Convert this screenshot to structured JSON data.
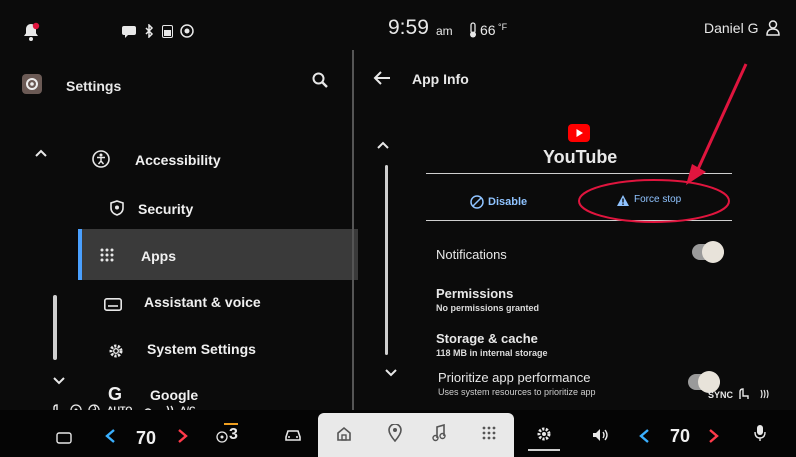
{
  "status": {
    "time": "9:59",
    "ampm": "am",
    "outside_temp": "66",
    "temp_unit": "°F",
    "user": "Daniel G"
  },
  "left": {
    "title": "Settings",
    "items": [
      {
        "label": "Accessibility",
        "icon": "accessibility-icon"
      },
      {
        "label": "Security",
        "icon": "shield-icon"
      },
      {
        "label": "Apps",
        "icon": "apps-grid-icon",
        "selected": true
      },
      {
        "label": "Assistant & voice",
        "icon": "keyboard-icon"
      },
      {
        "label": "System Settings",
        "icon": "gear-icon"
      },
      {
        "label": "Google",
        "icon": "google-icon"
      }
    ]
  },
  "right": {
    "title": "App Info",
    "app_name": "YouTube",
    "disable_label": "Disable",
    "force_stop_label": "Force stop",
    "notifications_label": "Notifications",
    "permissions_label": "Permissions",
    "permissions_sub": "No permissions granted",
    "storage_label": "Storage & cache",
    "storage_sub": "118 MB in internal storage",
    "prioritize_label": "Prioritize app performance",
    "prioritize_sub": "Uses system resources to prioritize app"
  },
  "climate": {
    "left_temp": "70",
    "right_temp": "70",
    "fan_level": "3",
    "auto_label": "AUTO",
    "ac_label": "A/C",
    "sync_label": "SYNC"
  },
  "colors": {
    "accent_blue": "#4aa0ff",
    "annotation_red": "#e0153e",
    "youtube_red": "#ff0000",
    "selected_bg": "#3a3a3a"
  }
}
